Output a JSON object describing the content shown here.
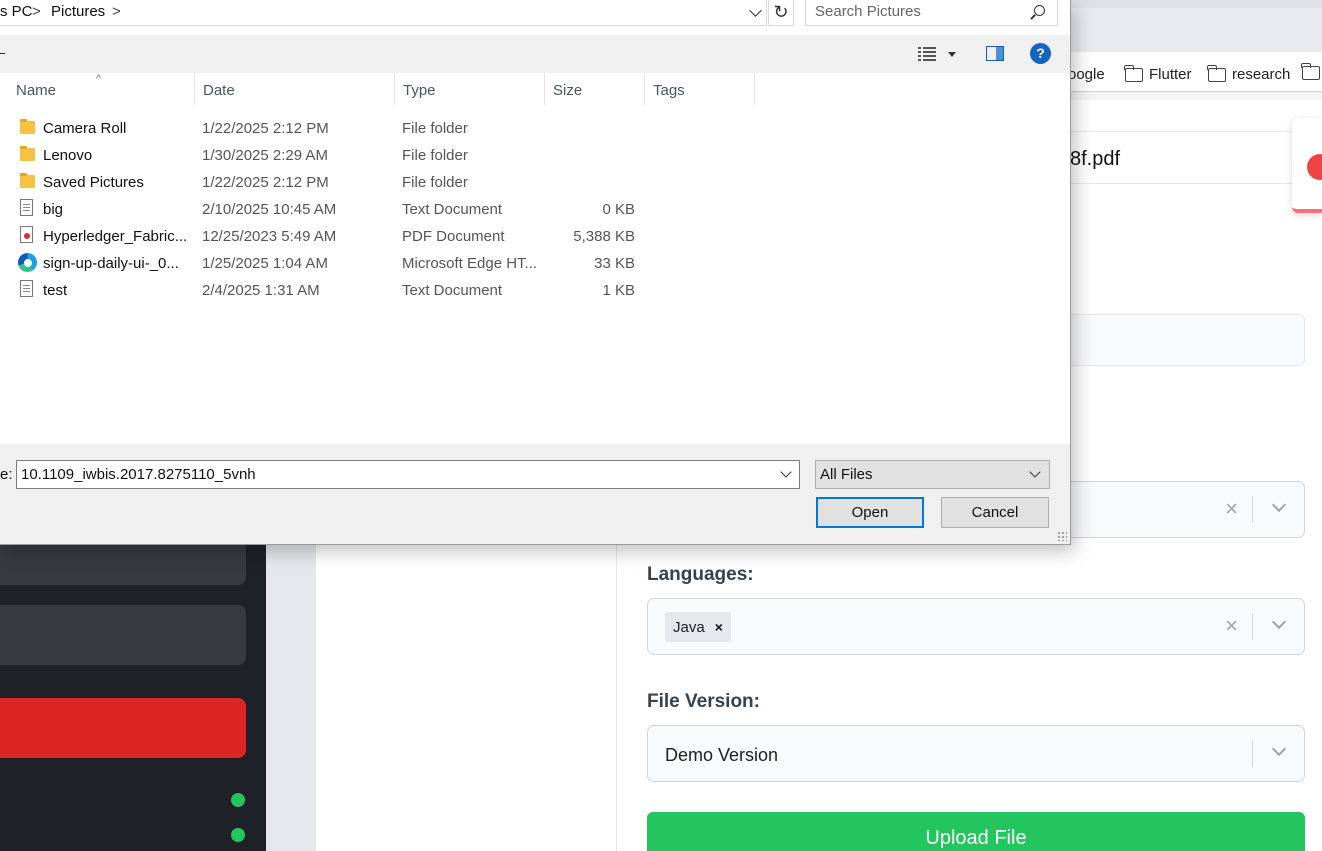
{
  "background_app": {
    "bookmarks": [
      "oogle",
      "Flutter",
      "research"
    ],
    "file_name_display": "8f.pdf",
    "languages_label": "Languages:",
    "languages_selected": [
      "Java"
    ],
    "tag_remove_glyph": "×",
    "clear_glyph": "×",
    "file_version_label": "File Version:",
    "file_version_value": "Demo Version",
    "upload_button": "Upload File",
    "colors": {
      "sidebar": "#1f2128",
      "danger": "#dc2626",
      "success": "#22c55e"
    }
  },
  "dialog": {
    "breadcrumb": [
      "s PC",
      "Pictures"
    ],
    "breadcrumb_separator": ">",
    "refresh_glyph": "↻",
    "search_placeholder": "Search Pictures",
    "help_glyph": "?",
    "sort_glyph": "^",
    "columns": {
      "name": "Name",
      "date": "Date",
      "type": "Type",
      "size": "Size",
      "tags": "Tags"
    },
    "files": [
      {
        "icon": "folder-icon",
        "name": "Camera Roll",
        "date": "1/22/2025 2:12 PM",
        "type": "File folder",
        "size": ""
      },
      {
        "icon": "folder-icon",
        "name": "Lenovo",
        "date": "1/30/2025 2:29 AM",
        "type": "File folder",
        "size": ""
      },
      {
        "icon": "folder-icon",
        "name": "Saved Pictures",
        "date": "1/22/2025 2:12 PM",
        "type": "File folder",
        "size": ""
      },
      {
        "icon": "text-file-icon",
        "name": "big",
        "date": "2/10/2025 10:45 AM",
        "type": "Text Document",
        "size": "0 KB"
      },
      {
        "icon": "pdf-file-icon",
        "name": "Hyperledger_Fabric...",
        "date": "12/25/2023 5:49 AM",
        "type": "PDF Document",
        "size": "5,388 KB"
      },
      {
        "icon": "edge-file-icon",
        "name": "sign-up-daily-ui-_0...",
        "date": "1/25/2025 1:04 AM",
        "type": "Microsoft Edge HT...",
        "size": "33 KB"
      },
      {
        "icon": "text-file-icon",
        "name": "test",
        "date": "2/4/2025 1:31 AM",
        "type": "Text Document",
        "size": "1 KB"
      }
    ],
    "filename_label": "e:",
    "filename_value": "10.1109_iwbis.2017.8275110_5vnh",
    "filetype_value": "All Files",
    "open_button": "Open",
    "cancel_button": "Cancel"
  }
}
